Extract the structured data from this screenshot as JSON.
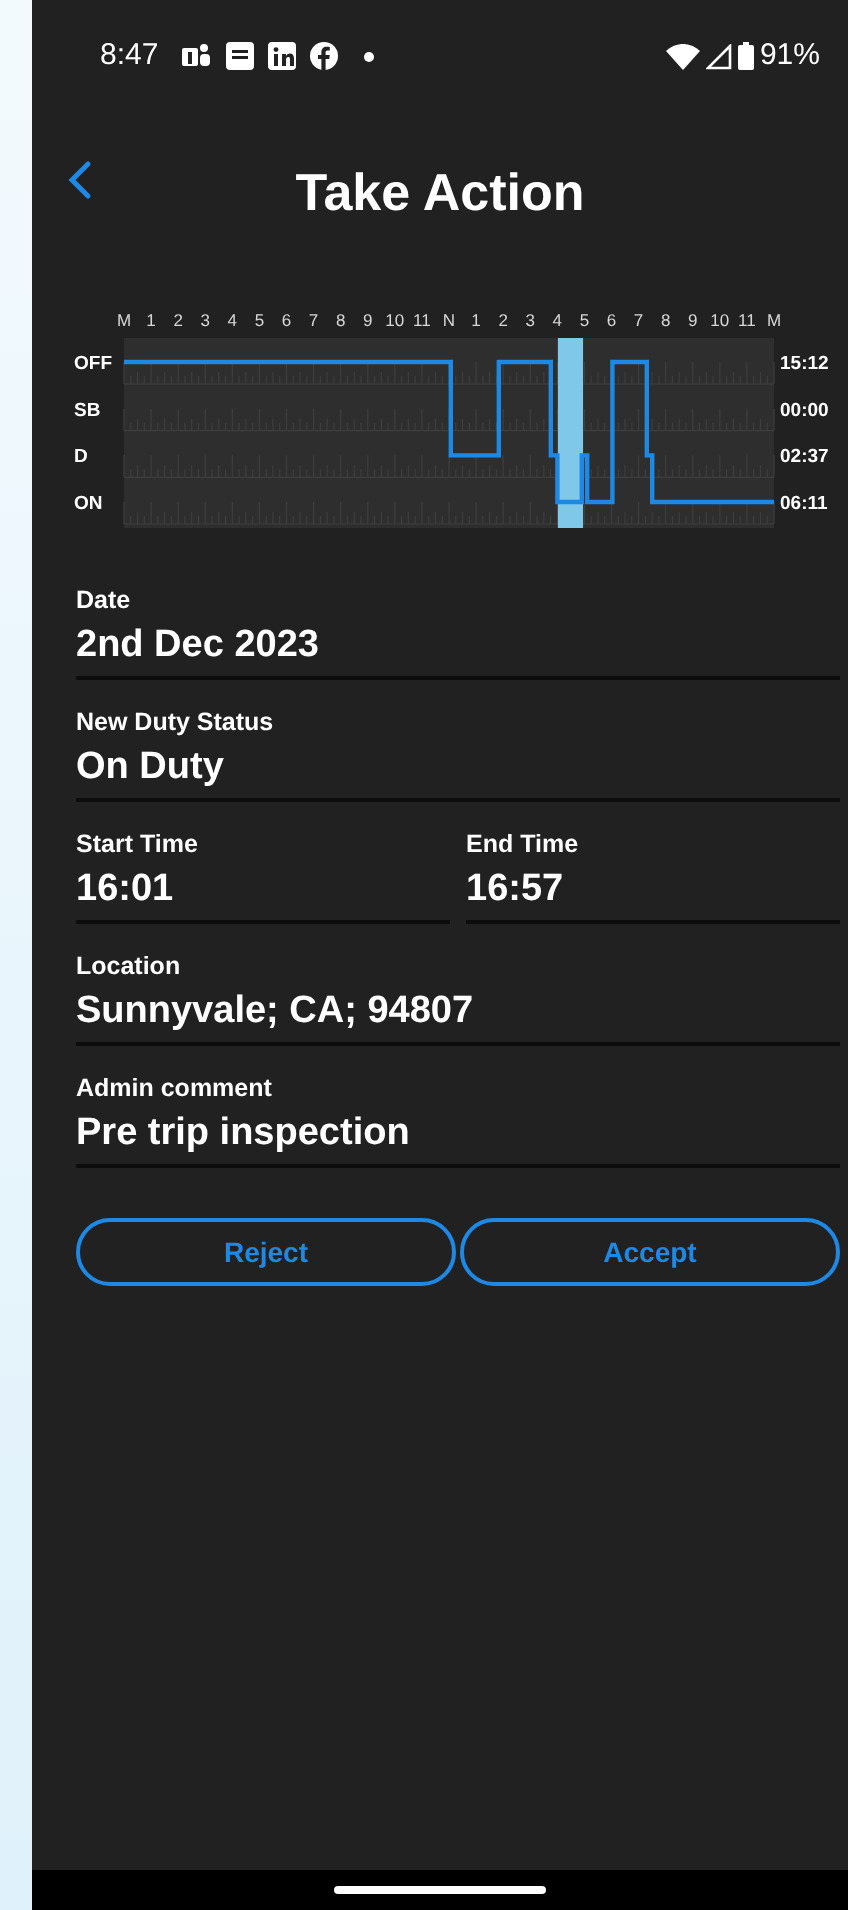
{
  "status_bar": {
    "time": "8:47",
    "battery": "91%"
  },
  "header": {
    "title": "Take Action"
  },
  "duty_chart": {
    "hour_labels": [
      "M",
      "1",
      "2",
      "3",
      "4",
      "5",
      "6",
      "7",
      "8",
      "9",
      "10",
      "11",
      "N",
      "1",
      "2",
      "3",
      "4",
      "5",
      "6",
      "7",
      "8",
      "9",
      "10",
      "11",
      "M"
    ],
    "status_labels": [
      "OFF",
      "SB",
      "D",
      "ON"
    ],
    "totals": [
      "15:12",
      "00:00",
      "02:37",
      "06:11"
    ]
  },
  "fields": [
    {
      "kind": "full",
      "label": "Date",
      "value": "2nd Dec 2023"
    },
    {
      "kind": "full",
      "label": "New Duty Status",
      "value": "On Duty"
    },
    {
      "kind": "pair",
      "items": [
        {
          "label": "Start Time",
          "value": "16:01"
        },
        {
          "label": "End Time",
          "value": "16:57"
        }
      ]
    },
    {
      "kind": "full",
      "label": "Location",
      "value": "Sunnyvale; CA; 94807"
    },
    {
      "kind": "full",
      "label": "Admin comment",
      "value": "Pre trip inspection"
    }
  ],
  "buttons": [
    "Reject",
    "Accept"
  ]
}
